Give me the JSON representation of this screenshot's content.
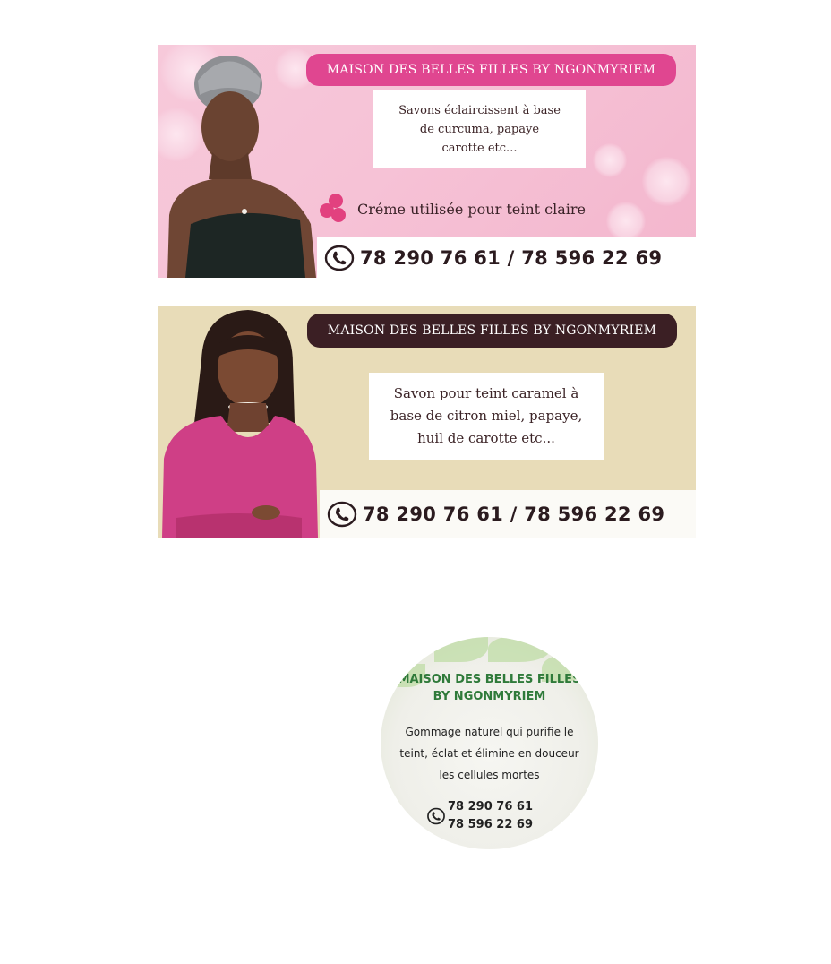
{
  "labels": [
    {
      "brand": "MAISON DES BELLES FILLES BY NGONMYRIEM",
      "description": [
        "Savons éclaircissent à base",
        "de curcuma, papaye",
        "carotte etc..."
      ],
      "tagline": "Créme utilisée pour teint claire",
      "phones": "78 290 76 61 / 78 596 22 69",
      "colors": {
        "background": "#f6c2d6",
        "pill": "#e04690",
        "accent": "#e2417f"
      }
    },
    {
      "brand": "MAISON DES BELLES FILLES BY NGONMYRIEM",
      "description": [
        "Savon pour teint caramel à",
        "base de citron miel, papaye,",
        "huil de carotte etc..."
      ],
      "phones": "78 290 76 61 / 78 596 22 69",
      "colors": {
        "background": "#e8dcb8",
        "pill": "#3b1f24"
      }
    },
    {
      "brand": [
        "MAISON DES BELLES FILLES",
        "BY NGONMYRIEM"
      ],
      "description": [
        "Gommage naturel qui purifie le",
        "teint, éclat et élimine en douceur",
        "les cellules mortes"
      ],
      "phones": [
        "78 290 76 61",
        "78 596 22 69"
      ],
      "colors": {
        "brand_text": "#2f7a3a",
        "leaf": "#bfdca6"
      }
    }
  ],
  "icons": [
    "phone-icon",
    "flower-bullet-icon",
    "woman-photo",
    "flower-decoration"
  ]
}
